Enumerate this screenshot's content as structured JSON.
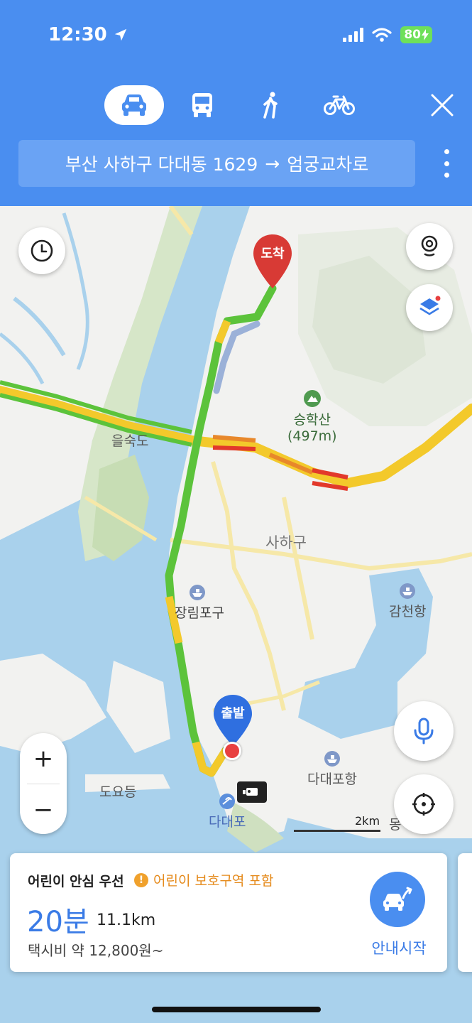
{
  "status_bar": {
    "time": "12:30",
    "battery": "80"
  },
  "header": {
    "modes": [
      {
        "name": "car",
        "active": true
      },
      {
        "name": "bus",
        "active": false
      },
      {
        "name": "walk",
        "active": false
      },
      {
        "name": "bike",
        "active": false
      }
    ],
    "route_from": "부산 사하구 다대동 1629",
    "route_arrow": "→",
    "route_to": "엄궁교차로"
  },
  "map": {
    "labels": {
      "destination": "도착",
      "origin": "출발",
      "mountain_name": "승학산",
      "mountain_height": "(497m)",
      "eulsukdo": "을숙도",
      "sahagu": "사하구",
      "jangnimpogu": "장림포구",
      "gamcheonhang": "감천항",
      "dadaepohang": "다대포항",
      "doyodeung": "도요등",
      "dadaepo": "다대포",
      "edge_label": "몽"
    },
    "scale": "2km",
    "zoom_in": "+",
    "zoom_out": "−"
  },
  "route_card": {
    "title": "어린이 안심 우선",
    "warning": "어린이 보호구역 포함",
    "duration": "20분",
    "distance": "11.1km",
    "fare": "택시비 약 12,800원~",
    "start_label": "안내시작"
  },
  "colors": {
    "header_blue": "#4a8ef0",
    "route_green": "#5cc33b",
    "route_yellow": "#f3c92b",
    "route_red": "#e2392b",
    "destination_pin": "#d83a35",
    "origin_pin": "#2f6fe0",
    "water": "#a9d1ec"
  }
}
